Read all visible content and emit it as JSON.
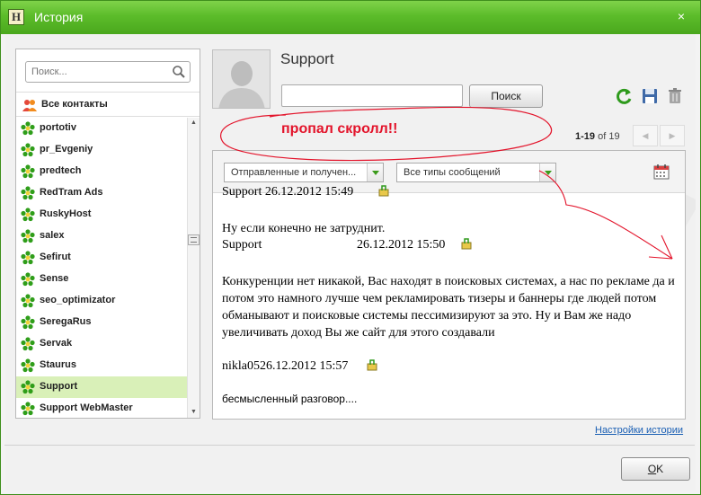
{
  "window": {
    "title": "История",
    "app_icon_letter": "H",
    "controls": {
      "close": "×"
    }
  },
  "sidebar": {
    "search_placeholder": "Поиск...",
    "all_contacts_label": "Все контакты",
    "contacts": [
      {
        "name": "portotiv",
        "selected": false
      },
      {
        "name": "pr_Evgeniy",
        "selected": false
      },
      {
        "name": "predtech",
        "selected": false
      },
      {
        "name": "RedTram Ads",
        "selected": false
      },
      {
        "name": "RuskyHost",
        "selected": false
      },
      {
        "name": "salex",
        "selected": false
      },
      {
        "name": "Sefirut",
        "selected": false
      },
      {
        "name": "Sense",
        "selected": false
      },
      {
        "name": "seo_optimizator",
        "selected": false
      },
      {
        "name": "SeregaRus",
        "selected": false
      },
      {
        "name": "Servak",
        "selected": false
      },
      {
        "name": "Staurus",
        "selected": false
      },
      {
        "name": "Support",
        "selected": true
      },
      {
        "name": "Support WebMaster",
        "selected": false
      }
    ]
  },
  "header": {
    "contact_name": "Support",
    "search_value": "",
    "search_button": "Поиск",
    "icons": [
      "refresh-icon",
      "save-icon",
      "trash-icon"
    ]
  },
  "annotation": {
    "note": "пропал скролл!!",
    "color": "#e3142b"
  },
  "pager": {
    "range": "1-19",
    "of_label": "of",
    "total": "19"
  },
  "filters": {
    "direction": "Отправленные и получен...",
    "type": "Все типы сообщений"
  },
  "messages": [
    {
      "kind": "cut_header",
      "text": "Support 26.12.2012 15:49"
    },
    {
      "kind": "text",
      "text": "Ну если конечно не затруднит."
    },
    {
      "kind": "meta",
      "sender": "Support",
      "timestamp": "26.12.2012 15:50"
    },
    {
      "kind": "text",
      "text": "Конкуренции нет никакой, Вас находят в поисковых системах, а нас по рекламе да и потом это намного лучше чем рекламировать тизеры и баннеры где людей потом обманывают и поисковые системы пессимизируют за это. Ну и Вам же надо увеличивать доход Вы же сайт для этого создавали"
    },
    {
      "kind": "meta",
      "sender": "nikla05",
      "timestamp": "26.12.2012 15:57"
    },
    {
      "kind": "text_sans",
      "text": "бесмысленный разговор...."
    }
  ],
  "footer": {
    "settings_link": "Настройки истории",
    "ok_button_accel": "O",
    "ok_button_rest": "K"
  },
  "colors": {
    "titlebar": "#5cbc2a",
    "selected_row": "#d9f0b8",
    "link": "#1a5fb4",
    "accent_green": "#3a9a1a"
  }
}
